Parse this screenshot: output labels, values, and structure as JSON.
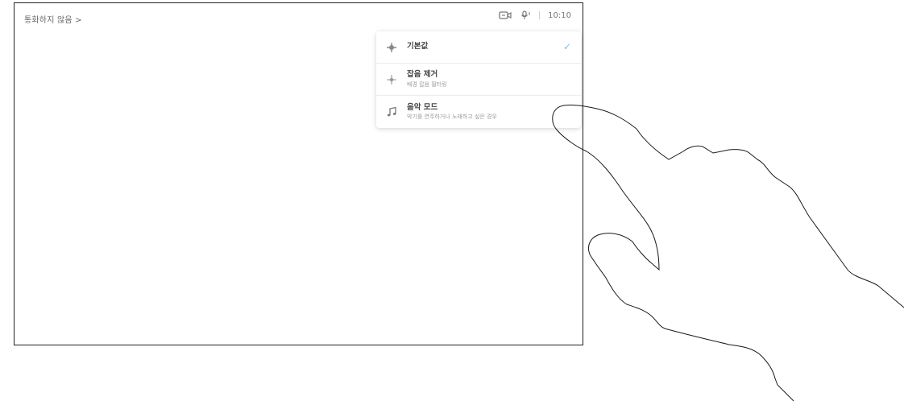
{
  "header": {
    "breadcrumb": "통화하지 않음 >",
    "camera_icon": "camera-icon",
    "mic_icon": "microphone-icon",
    "time": "10:10"
  },
  "noise_menu": {
    "items": [
      {
        "icon": "default-audio-icon",
        "title": "기본값",
        "description": "",
        "selected": true
      },
      {
        "icon": "noise-removal-icon",
        "title": "잡음 제거",
        "description": "배경 잡음 필터링"
      },
      {
        "icon": "music-note-icon",
        "title": "음악 모드",
        "description": "악기를 연주하거나 노래하고 싶은 경우"
      }
    ],
    "check_glyph": "✓",
    "accent_color": "#7ec3e6"
  },
  "overlay": {
    "hand_icon": "hand-gesture-illustration"
  }
}
